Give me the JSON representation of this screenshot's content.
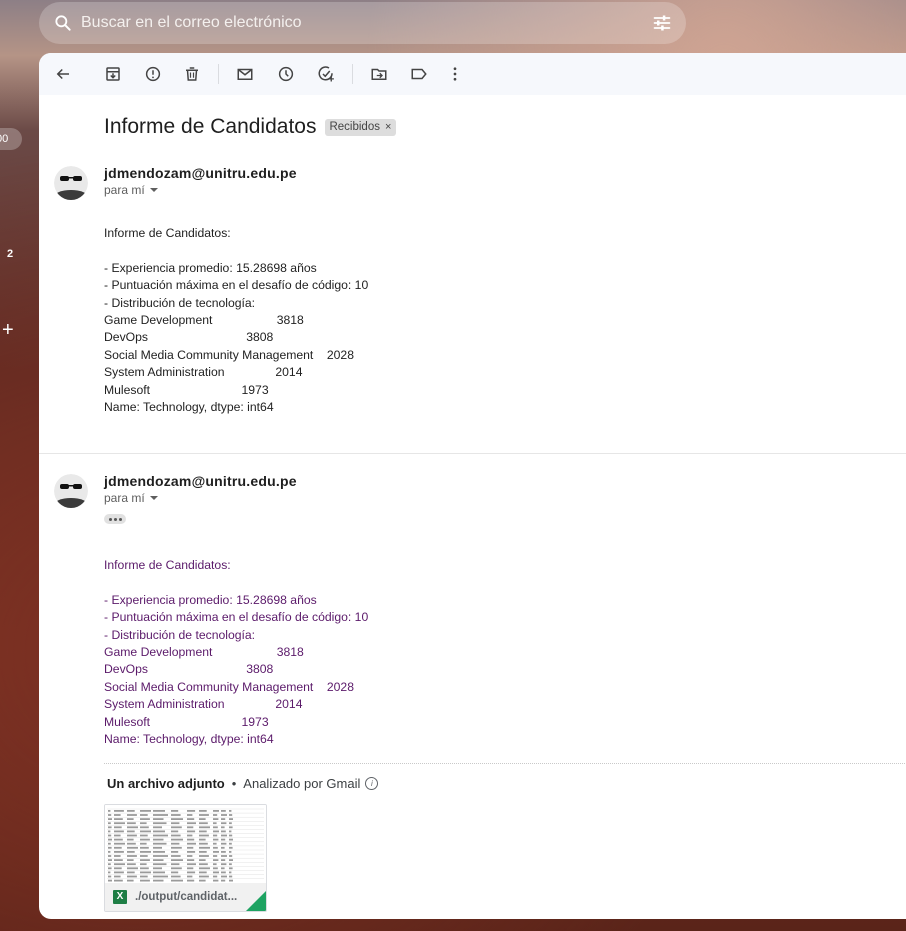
{
  "search": {
    "placeholder": "Buscar en el correo electrónico",
    "search_icon": "search-icon",
    "filter_icon": "tune-icon"
  },
  "leftrail": {
    "count_text": "00",
    "badge_text": "2",
    "plus_text": "+"
  },
  "toolbar": {
    "icons": [
      "back-arrow-icon",
      "archive-icon",
      "report-spam-icon",
      "delete-icon",
      "mark-unread-icon",
      "snooze-icon",
      "add-task-icon",
      "move-to-icon",
      "label-icon",
      "more-vert-icon"
    ]
  },
  "email": {
    "subject": "Informe de Candidatos",
    "label": "Recibidos",
    "label_close": "×"
  },
  "messages": [
    {
      "sender": "jdmendozam@unitru.edu.pe",
      "to": "para mí",
      "body": "Informe de Candidatos:\n\n- Experiencia promedio: 15.28698 años\n- Puntuación máxima en el desafío de código: 10\n- Distribución de tecnología:\nGame Development                   3818\nDevOps                             3808\nSocial Media Community Management    2028\nSystem Administration               2014\nMulesoft                           1973\nName: Technology, dtype: int64"
    },
    {
      "sender": "jdmendozam@unitru.edu.pe",
      "to": "para mí",
      "body": "Informe de Candidatos:\n\n- Experiencia promedio: 15.28698 años\n- Puntuación máxima en el desafío de código: 10\n- Distribución de tecnología:\nGame Development                   3818\nDevOps                             3808\nSocial Media Community Management    2028\nSystem Administration               2014\nMulesoft                           1973\nName: Technology, dtype: int64"
    }
  ],
  "attachments": {
    "header": "Un archivo adjunto",
    "separator": "•",
    "scanned": "Analizado por Gmail",
    "info_glyph": "i",
    "file_name": "./output/candidat...",
    "file_type_glyph": "X"
  }
}
